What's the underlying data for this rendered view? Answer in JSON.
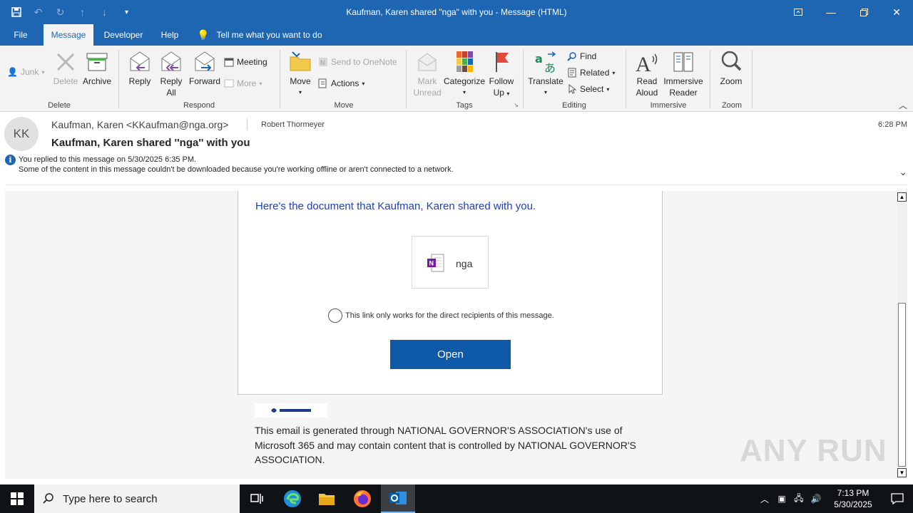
{
  "window": {
    "title": "Kaufman, Karen shared \"nga\" with you  -  Message (HTML)"
  },
  "tabs": [
    {
      "label": "File"
    },
    {
      "label": "Message"
    },
    {
      "label": "Developer"
    },
    {
      "label": "Help"
    }
  ],
  "tell_me": "Tell me what you want to do",
  "ribbon": {
    "delete_group": {
      "junk": "Junk",
      "delete": "Delete",
      "archive": "Archive",
      "label": "Delete"
    },
    "respond_group": {
      "reply": "Reply",
      "reply_all_1": "Reply",
      "reply_all_2": "All",
      "forward": "Forward",
      "meeting": "Meeting",
      "more": "More",
      "label": "Respond"
    },
    "move_group": {
      "move": "Move",
      "send_onenote": "Send to OneNote",
      "actions": "Actions",
      "label": "Move"
    },
    "tags_group": {
      "mark_unread_1": "Mark",
      "mark_unread_2": "Unread",
      "categorize": "Categorize",
      "follow_up_1": "Follow",
      "follow_up_2": "Up",
      "label": "Tags"
    },
    "editing_group": {
      "translate": "Translate",
      "find": "Find",
      "related": "Related",
      "select": "Select",
      "label": "Editing"
    },
    "immersive_group": {
      "read_aloud_1": "Read",
      "read_aloud_2": "Aloud",
      "immersive_reader_1": "Immersive",
      "immersive_reader_2": "Reader",
      "label": "Immersive"
    },
    "zoom_group": {
      "zoom": "Zoom",
      "label": "Zoom"
    }
  },
  "message": {
    "avatar_initials": "KK",
    "from": "Kaufman, Karen <KKaufman@nga.org>",
    "to": "Robert Thormeyer",
    "time": "6:28 PM",
    "subject": "Kaufman, Karen shared ''nga'' with you",
    "info_replied": "You replied to this message on 5/30/2025 6:35 PM.",
    "info_offline": "Some of the content in this message couldn't be downloaded because you're working offline or aren't connected to a network."
  },
  "body": {
    "heading": "Here's the document that Kaufman, Karen shared with you.",
    "doc_name": "nga",
    "link_note": "This link only works for the direct recipients of this message.",
    "open_button": "Open",
    "footer": "This email is generated through NATIONAL GOVERNOR'S ASSOCIATION's use of Microsoft 365 and may contain content that is controlled by NATIONAL GOVERNOR'S ASSOCIATION.",
    "watermark": "ANY RUN"
  },
  "taskbar": {
    "search_placeholder": "Type here to search",
    "time": "7:13 PM",
    "date": "5/30/2025"
  },
  "colors": {
    "title_blue": "#1f66b2",
    "open_button": "#0f5aa8",
    "heading_blue": "#1f3ec1"
  }
}
